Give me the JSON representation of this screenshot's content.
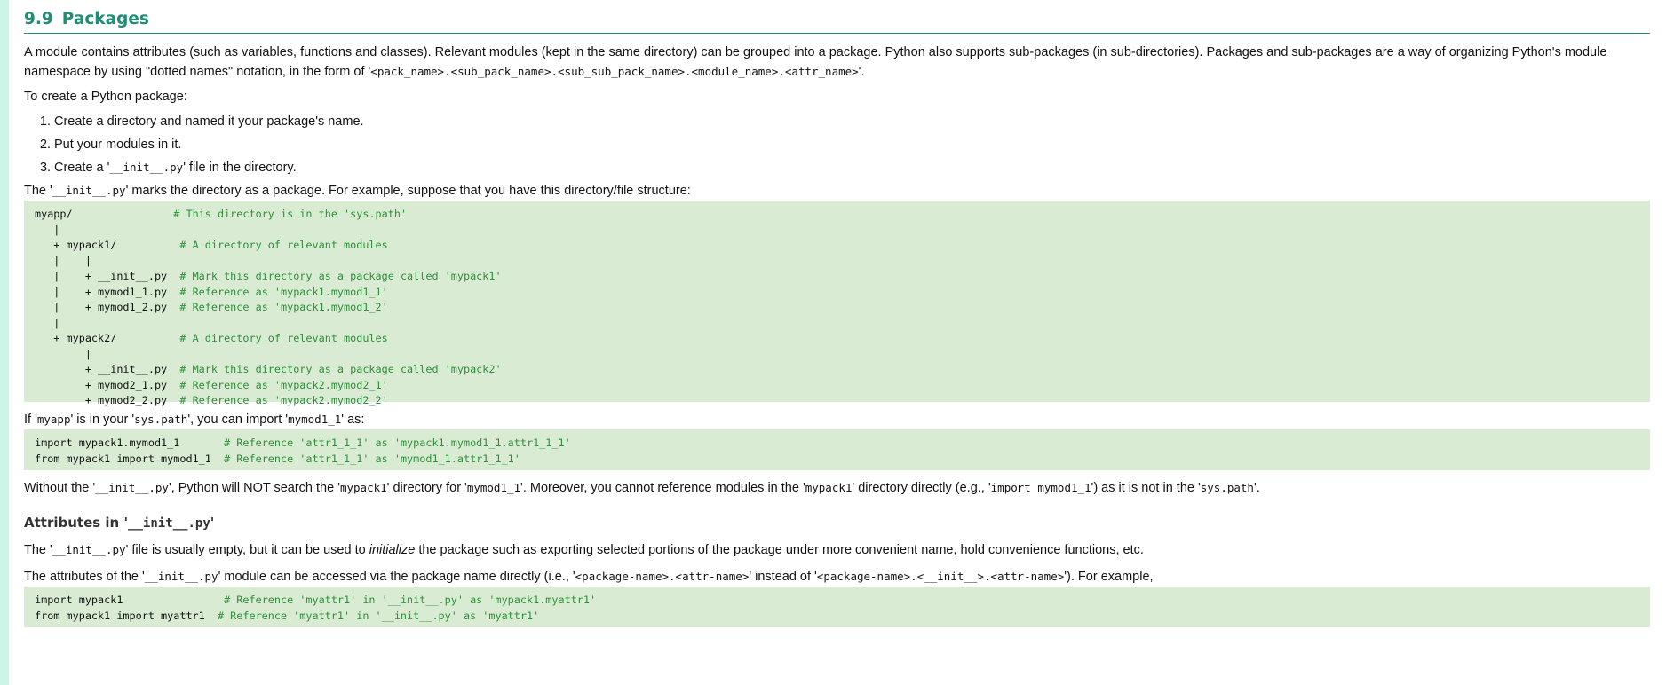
{
  "section": {
    "number": "9.9",
    "title": "Packages"
  },
  "intro": {
    "text": "A module contains attributes (such as variables, functions and classes). Relevant modules (kept in the same directory) can be grouped into a package. Python also supports sub-packages (in sub-directories). Packages and sub-packages are a way of organizing Python's module namespace by using \"dotted names\" notation, in the form of '",
    "code": "<pack_name>.<sub_pack_name>.<sub_sub_pack_name>.<module_name>.<attr_name>",
    "end": "'."
  },
  "create": {
    "heading": "To create a Python package:",
    "steps": [
      "Create a directory and named it your package's name.",
      "Put your modules in it."
    ],
    "step3_prefix": "Create a '",
    "step3_code": "__init__.py",
    "step3_suffix": "' file in the directory."
  },
  "marks": {
    "prefix": "The '",
    "code": "__init__.py",
    "suffix": "' marks the directory as a package. For example, suppose that you have this directory/file structure:"
  },
  "tree": {
    "lines": [
      {
        "text": "myapp/                ",
        "comment": "# This directory is in the 'sys.path'"
      },
      {
        "text": "   |",
        "comment": ""
      },
      {
        "text": "   + mypack1/          ",
        "comment": "# A directory of relevant modules"
      },
      {
        "text": "   |    |",
        "comment": ""
      },
      {
        "text": "   |    + __init__.py  ",
        "comment": "# Mark this directory as a package called 'mypack1'"
      },
      {
        "text": "   |    + mymod1_1.py  ",
        "comment": "# Reference as 'mypack1.mymod1_1'"
      },
      {
        "text": "   |    + mymod1_2.py  ",
        "comment": "# Reference as 'mypack1.mymod1_2'"
      },
      {
        "text": "   |",
        "comment": ""
      },
      {
        "text": "   + mypack2/          ",
        "comment": "# A directory of relevant modules"
      },
      {
        "text": "        |",
        "comment": ""
      },
      {
        "text": "        + __init__.py  ",
        "comment": "# Mark this directory as a package called 'mypack2'"
      },
      {
        "text": "        + mymod2_1.py  ",
        "comment": "# Reference as 'mypack2.mymod2_1'"
      },
      {
        "text": "        + mymod2_2.py  ",
        "comment": "# Reference as 'mypack2.mymod2_2'"
      }
    ]
  },
  "ifpath": {
    "p1": "If '",
    "c1": "myapp",
    "p2": "' is in your '",
    "c2": "sys.path",
    "p3": "', you can import '",
    "c3": "mymod1_1",
    "p4": "' as:"
  },
  "imports": {
    "lines": [
      {
        "text": "import mypack1.mymod1_1       ",
        "comment": "# Reference 'attr1_1_1' as 'mypack1.mymod1_1.attr1_1_1'"
      },
      {
        "text": "from mypack1 import mymod1_1  ",
        "comment": "# Reference 'attr1_1_1' as 'mymod1_1.attr1_1_1'"
      }
    ]
  },
  "without": {
    "p1": "Without the '",
    "c1": "__init__.py",
    "p2": "', Python will NOT search the '",
    "c2": "mypack1",
    "p3": "' directory for '",
    "c3": "mymod1_1",
    "p4": "'. Moreover, you cannot reference modules in the '",
    "c4": "mypack1",
    "p5": "' directory directly (e.g., '",
    "c5": "import mymod1_1",
    "p6": "') as it is not in the '",
    "c6": "sys.path",
    "p7": "'."
  },
  "attrs_section": {
    "title_prefix": "Attributes in '",
    "title_code": "__init__.py",
    "title_suffix": "'"
  },
  "init_usage": {
    "p1": "The '",
    "c1": "__init__.py",
    "p2": "' file is usually empty, but it can be used to ",
    "em": "initialize",
    "p3": " the package such as exporting selected portions of the package under more convenient name, hold convenience functions, etc."
  },
  "attr_access": {
    "p1": "The attributes of the '",
    "c1": "__init__.py",
    "p2": "' module can be accessed via the package name directly (i.e., '",
    "c2": "<package-name>.<attr-name>",
    "p3": "' instead of '",
    "c3": "<package-name>.<__init__>.<attr-name>",
    "p4": "'). For example,"
  },
  "attr_code": {
    "lines": [
      {
        "text": "import mypack1                ",
        "comment": "# Reference 'myattr1' in '__init__.py' as 'mypack1.myattr1'"
      },
      {
        "text": "from mypack1 import myattr1  ",
        "comment": "# Reference 'myattr1' in '__init__.py' as 'myattr1'"
      }
    ]
  },
  "colors": {
    "title": "#208e74",
    "code_bg": "#d9ecd3",
    "comment": "#2d8f3a",
    "stripe": "#ccf5e7"
  }
}
